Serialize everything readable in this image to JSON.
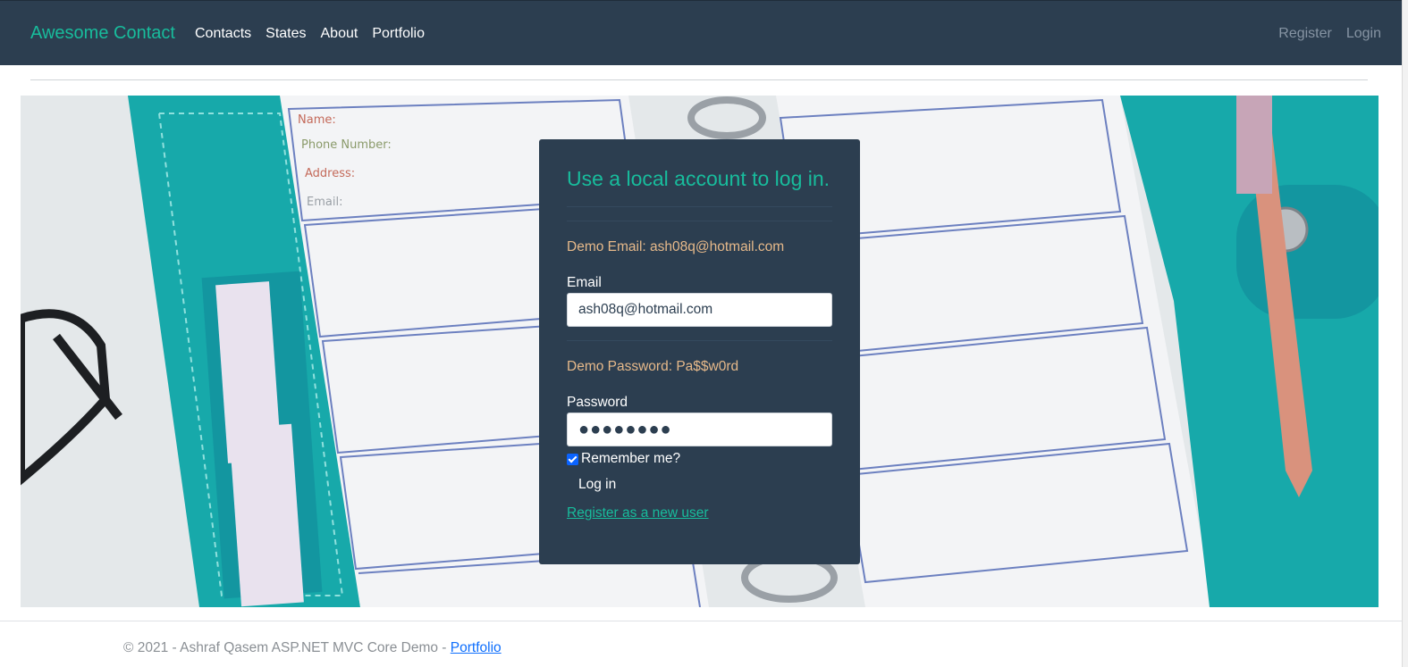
{
  "nav": {
    "brand": "Awesome Contact",
    "links": [
      "Contacts",
      "States",
      "About",
      "Portfolio"
    ],
    "auth": [
      "Register",
      "Login"
    ]
  },
  "login": {
    "title": "Use a local account to log in.",
    "demo_email_text": "Demo Email: ash08q@hotmail.com",
    "email_label": "Email",
    "email_value": "ash08q@hotmail.com",
    "demo_password_text": "Demo Password: Pa$$w0rd",
    "password_label": "Password",
    "password_masked": "●●●●●●●●",
    "remember_label": "Remember me?",
    "remember_checked": true,
    "login_button": "Log in",
    "register_link": "Register as a new user"
  },
  "hero": {
    "planner_labels": [
      "Name:",
      "Phone Number:",
      "Address:",
      "Email:"
    ]
  },
  "footer": {
    "text": "© 2021 - Ashraf Qasem ASP.NET MVC Core Demo - ",
    "link": "Portfolio"
  },
  "colors": {
    "navbar": "#2c3e50",
    "accent": "#18bc9c",
    "demo_text": "#e6b98a",
    "binder_teal": "#17a9aa"
  }
}
